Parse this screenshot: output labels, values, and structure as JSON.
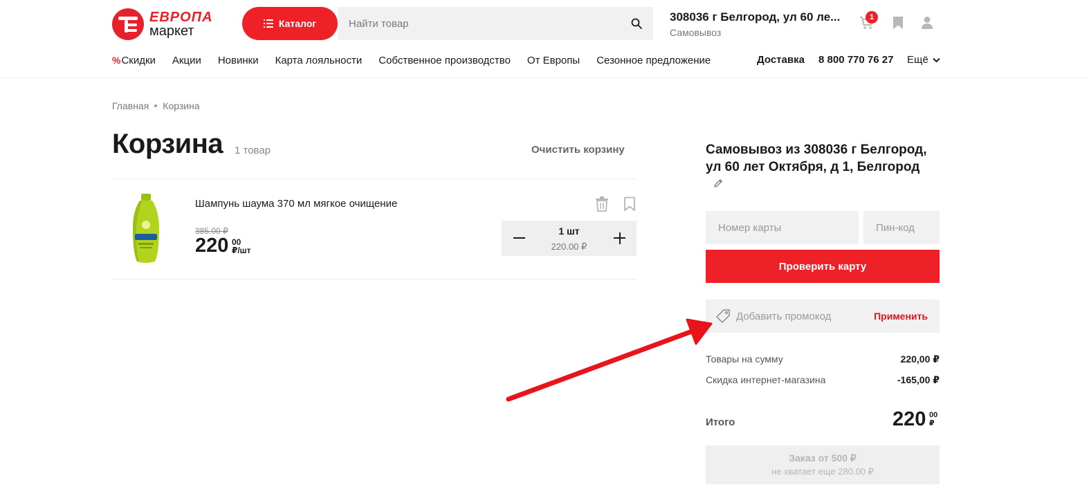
{
  "header": {
    "logo_top": "ЕВРОПА",
    "logo_bottom": "маркет",
    "catalog_label": "Каталог",
    "search_placeholder": "Найти товар",
    "address_title": "308036 г Белгород, ул 60 ле...",
    "address_subtitle": "Самовывоз",
    "cart_count": "1"
  },
  "nav": {
    "items": [
      "Скидки",
      "Акции",
      "Новинки",
      "Карта лояльности",
      "Собственное производство",
      "От Европы",
      "Сезонное предложение"
    ],
    "delivery": "Доставка",
    "phone": "8 800 770 76 27",
    "more": "Ещё"
  },
  "breadcrumb": {
    "home": "Главная",
    "current": "Корзина"
  },
  "cart": {
    "title": "Корзина",
    "count_label": "1 товар",
    "clear_label": "Очистить корзину",
    "items": [
      {
        "name": "Шампунь шаума 370 мл мягкое очищение",
        "old_price": "385.00 ₽",
        "price_int": "220",
        "price_cents": "00",
        "price_unit": "₽/шт",
        "quantity": "1 шт",
        "line_total": "220.00 ₽"
      }
    ]
  },
  "summary": {
    "pickup_title": "Самовывоз из 308036 г Белгород, ул 60 лет Октября, д 1, Белгород",
    "card_placeholder": "Номер карты",
    "pin_placeholder": "Пин-код",
    "check_card_label": "Проверить карту",
    "promo_placeholder": "Добавить промокод",
    "promo_apply": "Применить",
    "rows": [
      {
        "label": "Товары на сумму",
        "value": "220,00 ₽"
      },
      {
        "label": "Скидка интернет-магазина",
        "value": "-165,00 ₽"
      }
    ],
    "total_label": "Итого",
    "total_int": "220",
    "total_cents": "00",
    "total_currency": "₽",
    "order_line1": "Заказ от 500 ₽",
    "order_line2": "не хватает еще 280.00 ₽"
  },
  "colors": {
    "accent": "#ee2129",
    "annotation_arrow": "#e8131b"
  }
}
